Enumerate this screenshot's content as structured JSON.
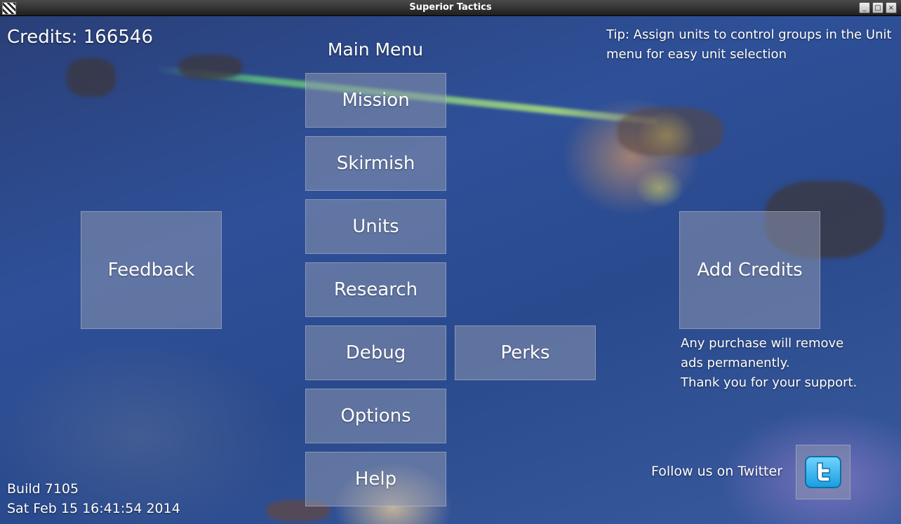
{
  "window": {
    "title": "Superior Tactics",
    "minimize_label": "_",
    "maximize_label": "□",
    "close_label": "×"
  },
  "header": {
    "credits": "Credits: 166546",
    "menu_title": "Main Menu",
    "tip": "Tip: Assign units to control groups in the Unit menu for easy unit selection"
  },
  "menu": {
    "mission": "Mission",
    "skirmish": "Skirmish",
    "units": "Units",
    "research": "Research",
    "debug": "Debug",
    "perks": "Perks",
    "options": "Options",
    "help": "Help"
  },
  "side": {
    "feedback": "Feedback",
    "add_credits": "Add Credits",
    "support_text": "Any purchase will remove\nads permanently.\nThank you for your support."
  },
  "footer": {
    "build": "Build 7105",
    "date": "Sat Feb 15 16:41:54 2014",
    "twitter_label": "Follow us on Twitter",
    "twitter_icon": "twitter-bird-icon"
  }
}
